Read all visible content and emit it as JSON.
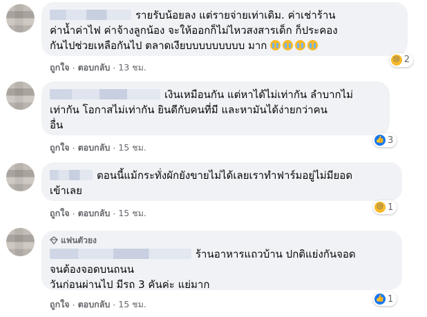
{
  "comments": [
    {
      "text_line1": "รายรับน้อยลง แต่รายจ่ายเท่าเดิม. ค่าเช่าร้าน",
      "text_line2": "ค่าน้ำค่าไฟ ค่าจ้างลูกน้อง จะให้ออกก็ไม่ไหวสงสารเด็ก ก็ประคอง",
      "text_line3": "กันไปช่วยเหลือกันไป ตลาดเงียบบบบบบบบบ มาก",
      "emojis": [
        "crying-face",
        "crying-face",
        "crying-face",
        "crying-face"
      ],
      "like": "ถูกใจ",
      "reply": "ตอบกลับ",
      "time": "13 ชม.",
      "reaction": "sad",
      "reaction_count": "2"
    },
    {
      "text_line1": "เงินเหมือนกัน แต่หาได้ไม่เท่ากัน ลำบากไม่",
      "text_line2": "เท่ากัน โอกาสไม่เท่ากัน ยินดีกับคนที่มี และหามันได้ง่ายกว่าคน",
      "text_line3": "อื่น",
      "like": "ถูกใจ",
      "reply": "ตอบกลับ",
      "time": "15 ชม.",
      "reaction": "like",
      "reaction_count": "3"
    },
    {
      "text_line1": "ตอนนี้แม้กระทั่งผักยังขายไม่ได้เลยเราทำฟาร์มอยู่ไม่มียอด",
      "text_line2": "เข้าเลย",
      "like": "ถูกใจ",
      "reply": "ตอบกลับ",
      "time": "15 ชม.",
      "reaction": "sad",
      "reaction_count": "1"
    },
    {
      "badge": "แฟนตัวยง",
      "text_line1": "ร้านอาหารแถวบ้าน ปกติแย่งกันจอด",
      "text_line2": "จนต้องจอดบนถนน",
      "text_line3": "วันก่อนผ่านไป มีรถ 3 คันค่ะ แย่มาก",
      "like": "ถูกใจ",
      "reply": "ตอบกลับ",
      "time": "15 ชม.",
      "reaction": "like",
      "reaction_count": "1"
    }
  ],
  "separator": "·",
  "colors": {
    "bubble": "#f0f2f5",
    "meta": "#65676b",
    "like_blue": "#1877f2",
    "sad_yellow": "#f7b928"
  }
}
